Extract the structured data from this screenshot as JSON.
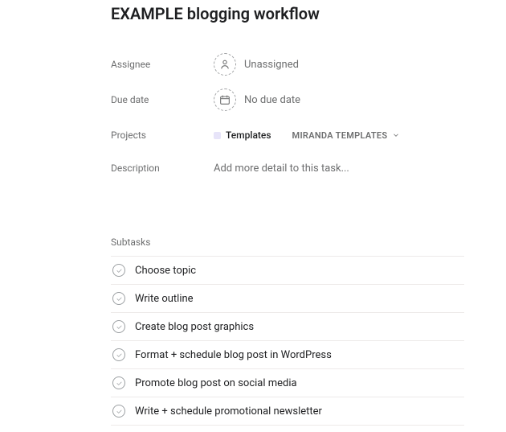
{
  "task": {
    "title": "EXAMPLE blogging workflow",
    "fields": {
      "assignee": {
        "label": "Assignee",
        "value": "Unassigned"
      },
      "dueDate": {
        "label": "Due date",
        "value": "No due date"
      },
      "projects": {
        "label": "Projects",
        "chip": "Templates",
        "section": "MIRANDA TEMPLATES"
      },
      "description": {
        "label": "Description",
        "placeholder": "Add more detail to this task..."
      }
    },
    "subtasksLabel": "Subtasks",
    "subtasks": [
      {
        "title": "Choose topic"
      },
      {
        "title": "Write outline"
      },
      {
        "title": "Create blog post graphics"
      },
      {
        "title": "Format + schedule blog post in WordPress"
      },
      {
        "title": "Promote blog post on social media"
      },
      {
        "title": "Write + schedule promotional newsletter"
      }
    ]
  }
}
